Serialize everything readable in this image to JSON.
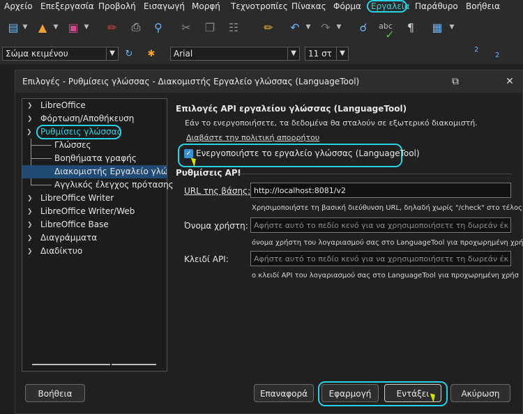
{
  "menubar": {
    "items": [
      "Αρχείο",
      "Επεξεργασία",
      "Προβολή",
      "Εισαγωγή",
      "Μορφή",
      "Τεχνοτροπίες",
      "Πίνακας",
      "Φόρμα",
      "Εργαλεία",
      "Παράθυρο",
      "Βοήθεια"
    ],
    "active": "Εργαλεία"
  },
  "toolbar": {
    "paragraph_style": "Σώμα κειμένου",
    "font_name": "Arial",
    "font_size": "11 στ",
    "superscript": "2",
    "subscript": "2",
    "icons": [
      "new-document-icon",
      "open-folder-icon",
      "save-icon",
      "export-pdf-icon",
      "print-icon",
      "print-preview-icon",
      "cut-icon",
      "copy-icon",
      "paste-icon",
      "clone-format-icon",
      "undo-icon",
      "redo-icon",
      "find-replace-icon",
      "spelling-icon",
      "auto-spellcheck-icon",
      "formatting-marks-icon",
      "insert-table-icon"
    ]
  },
  "dialog": {
    "title": "Επιλογές - Ρυθμίσεις γλώσσας - Διακομιστής Εργαλείο γλώσσας (LanguageTool)",
    "tree": [
      {
        "label": "LibreOffice",
        "level": 0,
        "expanded": false
      },
      {
        "label": "Φόρτωση/Αποθήκευση",
        "level": 0,
        "expanded": false
      },
      {
        "label": "Ρυθμίσεις γλώσσας",
        "level": 0,
        "expanded": true,
        "highlight": true
      },
      {
        "label": "Γλώσσες",
        "level": 1
      },
      {
        "label": "Βοηθήματα γραφής",
        "level": 1
      },
      {
        "label": "Διακομιστής Εργαλείο γλώσσας",
        "level": 1,
        "selected": true
      },
      {
        "label": "Αγγλικός έλεγχος πρότασης",
        "level": 1
      },
      {
        "label": "LibreOffice Writer",
        "level": 0,
        "expanded": false
      },
      {
        "label": "LibreOffice Writer/Web",
        "level": 0,
        "expanded": false
      },
      {
        "label": "LibreOffice Base",
        "level": 0,
        "expanded": false
      },
      {
        "label": "Διαγράμματα",
        "level": 0,
        "expanded": false
      },
      {
        "label": "Διαδίκτυο",
        "level": 0,
        "expanded": false
      }
    ],
    "section_title": "Επιλογές API εργαλείου γλώσσας (LanguageTool)",
    "info_text": "Εάν το ενεργοποιήσετε, τα δεδομένα θα σταλούν σε εξωτερικό διακομιστή.",
    "privacy_link": "Διαβάστε την πολιτική απορρήτου",
    "enable_checkbox_label": "Ενεργοποιήστε το εργαλείο γλώσσας (LanguageTool)",
    "enable_checked": true,
    "api_settings_title": "Ρυθμίσεις API",
    "base_url_label": "URL της βάσης:",
    "base_url_value": "http://localhost:8081/v2",
    "base_url_hint": "Χρησιμοποιήστε τη βασική διεύθυνση URL, δηλαδή χωρίς \"/check\" στο τέλος.",
    "username_label": "Όνομα χρήστη:",
    "username_placeholder": "Αφήστε αυτό το πεδίο κενό για να χρησιμοποιήσετε τη δωρεάν έκδο",
    "username_hint": "όνομα χρήστη του λογαριασμού σας στο LanguageTool για προχωρημένη χρή",
    "apikey_label": "Κλειδί API:",
    "apikey_placeholder": "Αφήστε αυτό το πεδίο κενό για να χρησιμοποιήσετε τη δωρεάν έκδο",
    "apikey_hint": "ο κλειδί API του λογαριασμού σας στο LanguageTool για προχωρημένη χρήσ",
    "buttons": {
      "help": "Βοήθεια",
      "reset": "Επαναφορά",
      "apply": "Εφαρμογή",
      "ok": "Εντάξει",
      "cancel": "Ακύρωση"
    }
  },
  "colors": {
    "accent_highlight": "#2ad1e6",
    "selection": "#204a73",
    "link": "#3a8fd1",
    "background": "#202020"
  }
}
